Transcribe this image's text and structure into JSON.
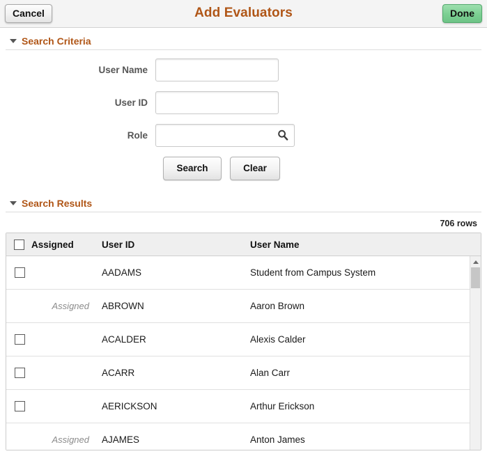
{
  "header": {
    "cancel_label": "Cancel",
    "title": "Add Evaluators",
    "done_label": "Done",
    "title_color": "#b05617",
    "done_color": "#7bcf92"
  },
  "search_criteria": {
    "section_title": "Search Criteria",
    "fields": [
      {
        "label": "User Name",
        "value": "",
        "placeholder": ""
      },
      {
        "label": "User ID",
        "value": "",
        "placeholder": ""
      },
      {
        "label": "Role",
        "value": "",
        "placeholder": "",
        "lookup_icon": "search-icon"
      }
    ],
    "search_label": "Search",
    "clear_label": "Clear"
  },
  "search_results": {
    "section_title": "Search Results",
    "row_count": "706 rows",
    "columns": {
      "select_all": "",
      "assigned": "Assigned",
      "user_id": "User ID",
      "user_name": "User Name"
    },
    "rows": [
      {
        "assigned": false,
        "assigned_label": "",
        "user_id": "AADAMS",
        "user_name": "Student from Campus System"
      },
      {
        "assigned": true,
        "assigned_label": "Assigned",
        "user_id": "ABROWN",
        "user_name": "Aaron Brown"
      },
      {
        "assigned": false,
        "assigned_label": "",
        "user_id": "ACALDER",
        "user_name": "Alexis Calder"
      },
      {
        "assigned": false,
        "assigned_label": "",
        "user_id": "ACARR",
        "user_name": "Alan Carr"
      },
      {
        "assigned": false,
        "assigned_label": "",
        "user_id": "AERICKSON",
        "user_name": "Arthur Erickson"
      },
      {
        "assigned": true,
        "assigned_label": "Assigned",
        "user_id": "AJAMES",
        "user_name": "Anton James"
      }
    ]
  }
}
